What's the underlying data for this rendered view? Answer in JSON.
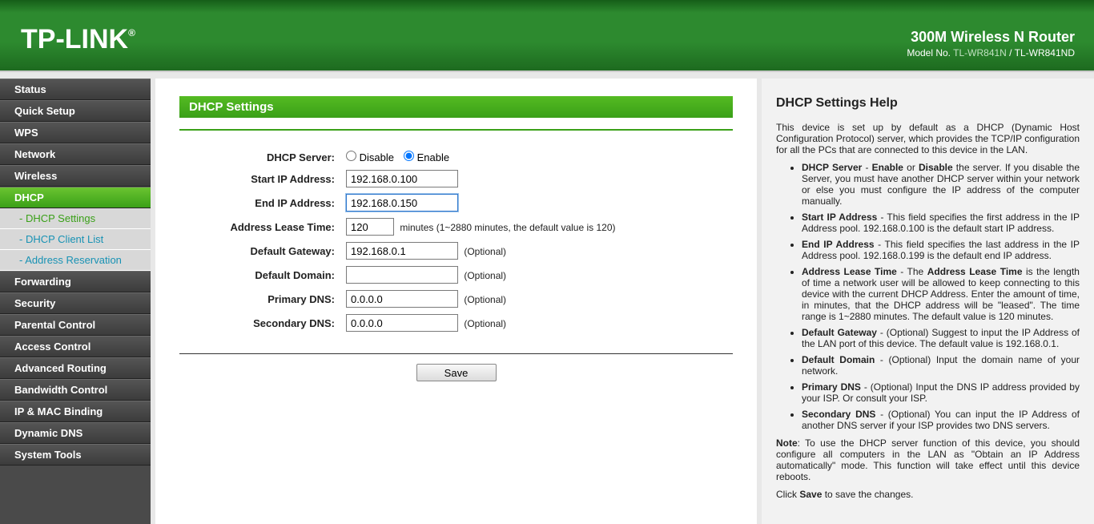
{
  "header": {
    "brand": "TP-LINK",
    "brand_mark": "®",
    "product_title": "300M Wireless N Router",
    "model_prefix": "Model No.",
    "model_link": "TL-WR841N",
    "model_sep": " / ",
    "model_alt": "TL-WR841ND"
  },
  "sidebar": {
    "items": [
      {
        "label": "Status",
        "active": false,
        "sub": false
      },
      {
        "label": "Quick Setup",
        "active": false,
        "sub": false
      },
      {
        "label": "WPS",
        "active": false,
        "sub": false
      },
      {
        "label": "Network",
        "active": false,
        "sub": false
      },
      {
        "label": "Wireless",
        "active": false,
        "sub": false
      },
      {
        "label": "DHCP",
        "active": true,
        "sub": false
      },
      {
        "label": "DHCP Settings",
        "active": false,
        "sub": true,
        "sel": true
      },
      {
        "label": "DHCP Client List",
        "active": false,
        "sub": true
      },
      {
        "label": "Address Reservation",
        "active": false,
        "sub": true
      },
      {
        "label": "Forwarding",
        "active": false,
        "sub": false
      },
      {
        "label": "Security",
        "active": false,
        "sub": false
      },
      {
        "label": "Parental Control",
        "active": false,
        "sub": false
      },
      {
        "label": "Access Control",
        "active": false,
        "sub": false
      },
      {
        "label": "Advanced Routing",
        "active": false,
        "sub": false
      },
      {
        "label": "Bandwidth Control",
        "active": false,
        "sub": false
      },
      {
        "label": "IP & MAC Binding",
        "active": false,
        "sub": false
      },
      {
        "label": "Dynamic DNS",
        "active": false,
        "sub": false
      },
      {
        "label": "System Tools",
        "active": false,
        "sub": false
      }
    ]
  },
  "page": {
    "title": "DHCP Settings",
    "form": {
      "dhcp_server_label": "DHCP Server:",
      "disable_label": "Disable",
      "enable_label": "Enable",
      "dhcp_server_value": "enable",
      "start_ip_label": "Start IP Address:",
      "start_ip_value": "192.168.0.100",
      "end_ip_label": "End IP Address:",
      "end_ip_value": "192.168.0.150",
      "lease_label": "Address Lease Time:",
      "lease_value": "120",
      "lease_hint": "minutes (1~2880 minutes, the default value is 120)",
      "gateway_label": "Default Gateway:",
      "gateway_value": "192.168.0.1",
      "optional": "(Optional)",
      "domain_label": "Default Domain:",
      "domain_value": "",
      "dns1_label": "Primary DNS:",
      "dns1_value": "0.0.0.0",
      "dns2_label": "Secondary DNS:",
      "dns2_value": "0.0.0.0",
      "save_label": "Save"
    }
  },
  "help": {
    "title": "DHCP Settings Help",
    "intro": "This device is set up by default as a DHCP (Dynamic Host Configuration Protocol) server, which provides the TCP/IP configuration for all the PCs that are connected to this device in the LAN.",
    "items": [
      {
        "term": "DHCP Server",
        "text": " - Enable or Disable the server. If you disable the Server, you must have another DHCP server within your network or else you must configure the IP address of the computer manually."
      },
      {
        "term": "Start IP Address",
        "text": " - This field specifies the first address in the IP Address pool. 192.168.0.100 is the default start IP address."
      },
      {
        "term": "End IP Address",
        "text": " - This field specifies the last address in the IP Address pool. 192.168.0.199 is the default end IP address."
      },
      {
        "term": "Address Lease Time",
        "text": " - The Address Lease Time is the length of time a network user will be allowed to keep connecting to this device with the current DHCP Address. Enter the amount of time, in minutes, that the DHCP address will be \"leased\". The time range is 1~2880 minutes. The default value is 120 minutes."
      },
      {
        "term": "Default Gateway",
        "text": " - (Optional) Suggest to input the IP Address of the LAN port of this device. The default value is 192.168.0.1."
      },
      {
        "term": "Default Domain",
        "text": " - (Optional) Input the domain name of your network."
      },
      {
        "term": "Primary DNS",
        "text": " - (Optional) Input the DNS IP address provided by your ISP. Or consult your ISP."
      },
      {
        "term": "Secondary DNS",
        "text": " - (Optional) You can input the IP Address of another DNS server if your ISP provides two DNS servers."
      }
    ],
    "note_label": "Note",
    "note": ": To use the DHCP server function of this device, you should configure all computers in the LAN as \"Obtain an IP Address automatically\" mode. This function will take effect until this device reboots.",
    "save_hint_pre": "Click ",
    "save_hint_b": "Save",
    "save_hint_post": " to save the changes."
  }
}
